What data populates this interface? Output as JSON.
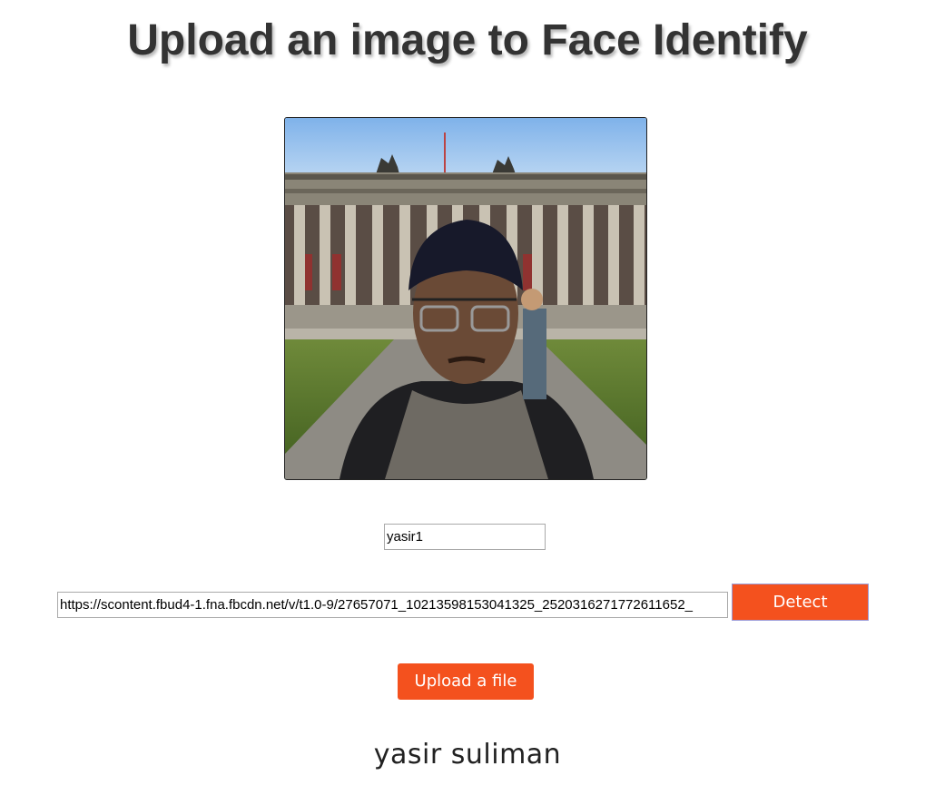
{
  "header": {
    "title": "Upload an image to Face Identify"
  },
  "photo": {
    "icon": "face-photo-image"
  },
  "form": {
    "name_value": "yasir1",
    "url_value": "https://scontent.fbud4-1.fna.fbcdn.net/v/t1.0-9/27657071_10213598153041325_2520316271772611652_",
    "detect_label": "Detect",
    "upload_label": "Upload a file"
  },
  "result": {
    "name": "yasir suliman"
  },
  "colors": {
    "accent": "#f4511e",
    "title": "#333333"
  }
}
